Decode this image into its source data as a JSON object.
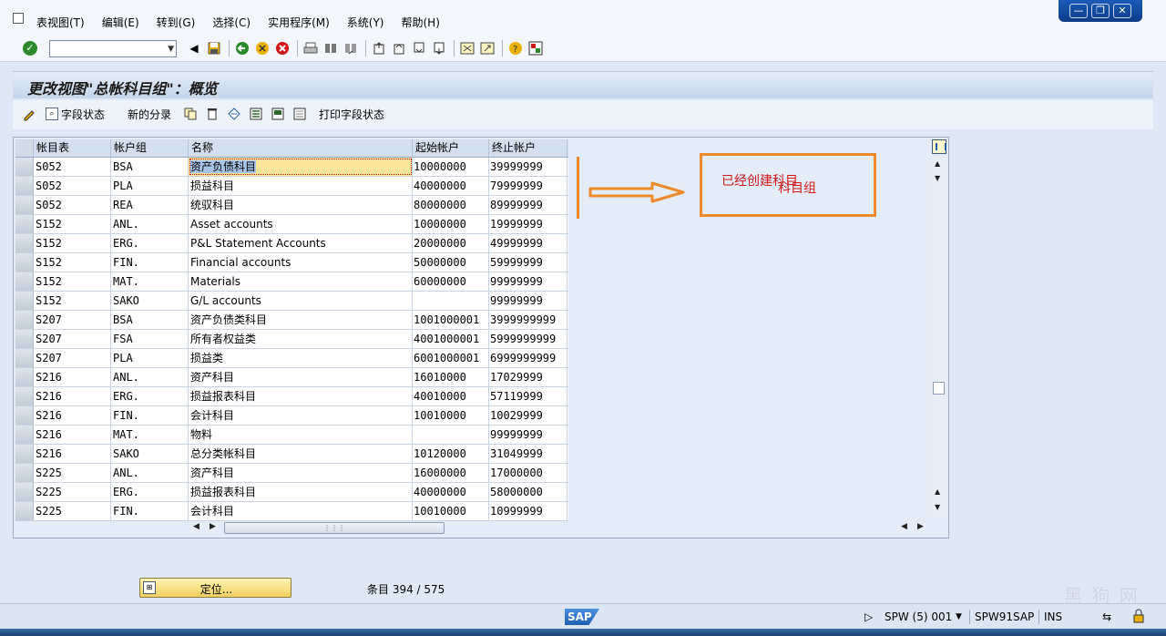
{
  "menu": {
    "items": [
      "表视图(T)",
      "编辑(E)",
      "转到(G)",
      "选择(C)",
      "实用程序(M)",
      "系统(Y)",
      "帮助(H)"
    ]
  },
  "window_controls": {
    "minimize": "—",
    "restore": "❐",
    "close": "✕"
  },
  "toolbar": {
    "command_field_value": ""
  },
  "title": "更改视图\"总帐科目组\"：概览",
  "app_toolbar": {
    "field_status_label": "字段状态",
    "new_entries_label": "新的分录",
    "print_field_status_label": "打印字段状态"
  },
  "table": {
    "columns": [
      "帐目表",
      "帐户组",
      "名称",
      "起始帐户",
      "终止帐户"
    ],
    "rows": [
      [
        "S052",
        "BSA",
        "资产负债科目",
        "10000000",
        "39999999"
      ],
      [
        "S052",
        "PLA",
        "损益科目",
        "40000000",
        "79999999"
      ],
      [
        "S052",
        "REA",
        "统驭科目",
        "80000000",
        "89999999"
      ],
      [
        "S152",
        "ANL.",
        "Asset accounts",
        "10000000",
        "19999999"
      ],
      [
        "S152",
        "ERG.",
        "P&L Statement Accounts",
        "20000000",
        "49999999"
      ],
      [
        "S152",
        "FIN.",
        "Financial accounts",
        "50000000",
        "59999999"
      ],
      [
        "S152",
        "MAT.",
        "Materials",
        "60000000",
        "99999999"
      ],
      [
        "S152",
        "SAKO",
        "G/L accounts",
        "",
        "99999999"
      ],
      [
        "S207",
        "BSA",
        "资产负债类科目",
        "1001000001",
        "3999999999"
      ],
      [
        "S207",
        "FSA",
        "所有者权益类",
        "4001000001",
        "5999999999"
      ],
      [
        "S207",
        "PLA",
        "损益类",
        "6001000001",
        "6999999999"
      ],
      [
        "S216",
        "ANL.",
        "资产科目",
        "16010000",
        "17029999"
      ],
      [
        "S216",
        "ERG.",
        "损益报表科目",
        "40010000",
        "57119999"
      ],
      [
        "S216",
        "FIN.",
        "会计科目",
        "10010000",
        "10029999"
      ],
      [
        "S216",
        "MAT.",
        "物料",
        "",
        "99999999"
      ],
      [
        "S216",
        "SAKO",
        "总分类帐科目",
        "10120000",
        "31049999"
      ],
      [
        "S225",
        "ANL.",
        "资产科目",
        "16000000",
        "17000000"
      ],
      [
        "S225",
        "ERG.",
        "损益报表科目",
        "40000000",
        "58000000"
      ],
      [
        "S225",
        "FIN.",
        "会计科目",
        "10010000",
        "10999999"
      ]
    ]
  },
  "annotation": {
    "text_line1": "已经创建科目",
    "text_line2": "科目组"
  },
  "bottom": {
    "position_button": "定位...",
    "entries_label": "条目 394 / 575"
  },
  "status": {
    "sap_logo": "SAP",
    "system": "SPW (5) 001",
    "server": "SPW91SAP",
    "mode": "INS"
  },
  "watermark": "黑 狗 网",
  "colors": {
    "annotation_orange": "#ef8a2a",
    "annotation_red": "#d21818",
    "focus_cell": "#fde59a"
  }
}
